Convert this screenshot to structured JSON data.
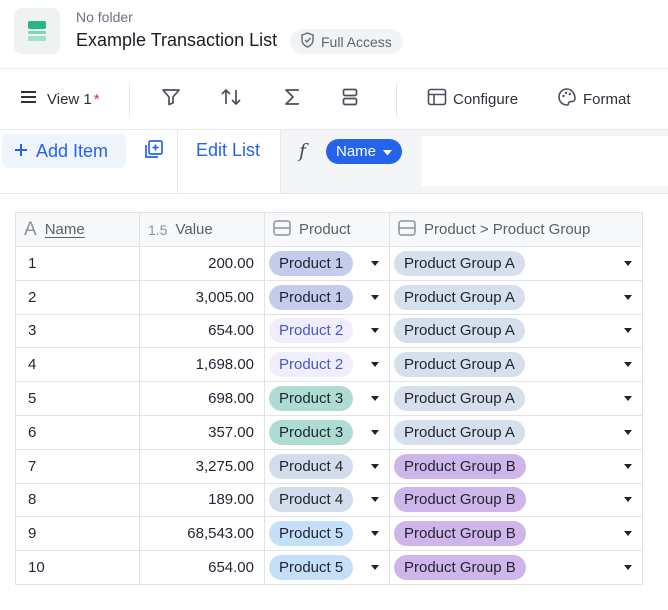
{
  "header": {
    "folder": "No folder",
    "title": "Example Transaction List",
    "access": "Full Access"
  },
  "toolbar": {
    "view_label": "View 1",
    "view_modified_mark": "*",
    "configure_label": "Configure",
    "format_label": "Format"
  },
  "actions": {
    "add_item_label": "Add Item",
    "edit_list_label": "Edit List",
    "formula_chip_label": "Name"
  },
  "grid": {
    "columns": [
      {
        "label": "Name",
        "icon": "text-type-icon",
        "icon_glyph": "A"
      },
      {
        "label": "Value",
        "icon": "number-type-icon",
        "icon_glyph": "1.5"
      },
      {
        "label": "Product",
        "icon": "list-type-icon"
      },
      {
        "label": "Product > Product Group",
        "icon": "list-type-icon"
      }
    ],
    "rows": [
      {
        "name": "1",
        "value": "200.00",
        "product": "Product 1",
        "group": "Product Group A"
      },
      {
        "name": "2",
        "value": "3,005.00",
        "product": "Product 1",
        "group": "Product Group A"
      },
      {
        "name": "3",
        "value": "654.00",
        "product": "Product 2",
        "group": "Product Group A"
      },
      {
        "name": "4",
        "value": "1,698.00",
        "product": "Product 2",
        "group": "Product Group A"
      },
      {
        "name": "5",
        "value": "698.00",
        "product": "Product 3",
        "group": "Product Group A"
      },
      {
        "name": "6",
        "value": "357.00",
        "product": "Product 3",
        "group": "Product Group A"
      },
      {
        "name": "7",
        "value": "3,275.00",
        "product": "Product 4",
        "group": "Product Group B"
      },
      {
        "name": "8",
        "value": "189.00",
        "product": "Product 4",
        "group": "Product Group B"
      },
      {
        "name": "9",
        "value": "68,543.00",
        "product": "Product 5",
        "group": "Product Group B"
      },
      {
        "name": "10",
        "value": "654.00",
        "product": "Product 5",
        "group": "Product Group B"
      }
    ]
  },
  "colors": {
    "accent": "#2563eb",
    "unsaved_marker": "#d9303e",
    "pill_product_1": "#c5cbec",
    "pill_product_2": "#eeeefc",
    "pill_product_3": "#aedcd2",
    "pill_product_4": "#d2dcea",
    "pill_product_5": "#c3dffa",
    "pill_group_a": "#d5e0ec",
    "pill_group_b": "#cfb6ea"
  }
}
